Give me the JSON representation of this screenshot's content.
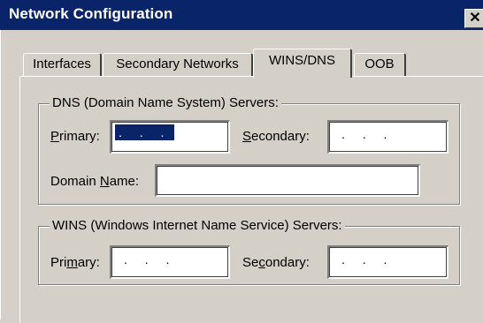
{
  "window": {
    "title": "Network Configuration",
    "close_glyph": "✕"
  },
  "tabs": [
    {
      "label": "Interfaces",
      "selected": false
    },
    {
      "label": "Secondary Networks",
      "selected": false
    },
    {
      "label": "WINS/DNS",
      "selected": true
    },
    {
      "label": "OOB",
      "selected": false
    }
  ],
  "dns": {
    "group_label": "DNS (Domain Name System) Servers:",
    "primary_label_pre": "",
    "primary_label_u": "P",
    "primary_label_post": "rimary:",
    "primary_value": ". . .",
    "secondary_label_pre": "",
    "secondary_label_u": "S",
    "secondary_label_post": "econdary:",
    "secondary_value": ". . .",
    "domain_label_pre": "Domain ",
    "domain_label_u": "N",
    "domain_label_post": "ame:",
    "domain_value": ""
  },
  "wins": {
    "group_label": "WINS (Windows Internet Name Service) Servers:",
    "primary_label_pre": "Pri",
    "primary_label_u": "m",
    "primary_label_post": "ary:",
    "primary_value": ". . .",
    "secondary_label_pre": "Se",
    "secondary_label_u": "c",
    "secondary_label_post": "ondary:",
    "secondary_value": ". . ."
  },
  "colors": {
    "titlebar": "#0a246a",
    "face": "#d4d0c8",
    "selection": "#0a246a"
  }
}
